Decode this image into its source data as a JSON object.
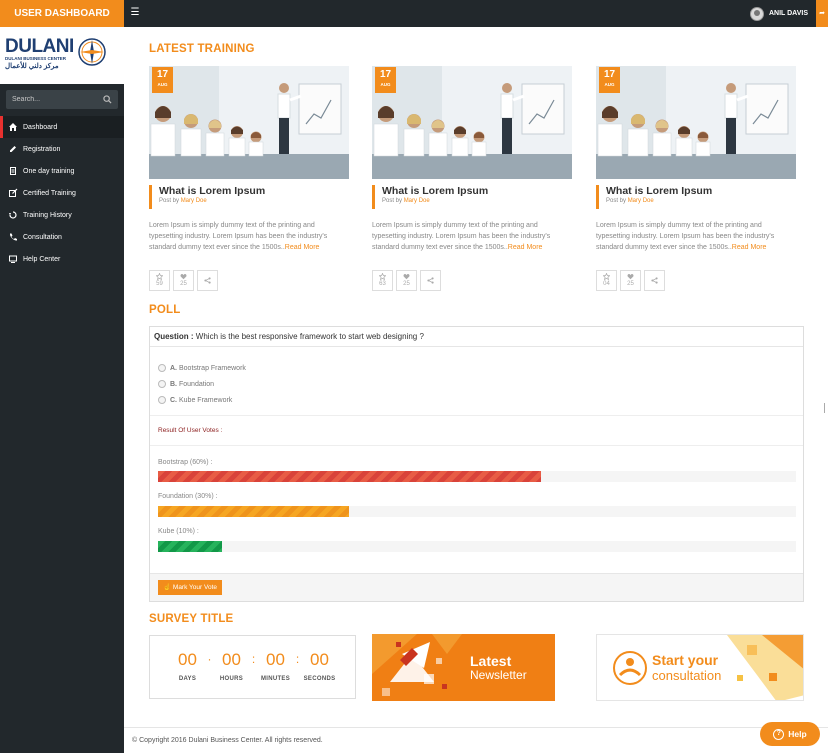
{
  "header": {
    "brand": "USER DASHBOARD",
    "user_name": "ANIL DAVIS"
  },
  "sidebar": {
    "logo_text": "DULANI",
    "logo_sub": "DULANI BUSINESS CENTER",
    "logo_arabic": "مركز دلني للأعمال",
    "search_placeholder": "Search...",
    "items": [
      {
        "label": "Dashboard",
        "icon": "home-icon",
        "active": true
      },
      {
        "label": "Registration",
        "icon": "pencil-icon"
      },
      {
        "label": "One day training",
        "icon": "document-icon"
      },
      {
        "label": "Certified Training",
        "icon": "edit-icon"
      },
      {
        "label": "Training History",
        "icon": "history-icon"
      },
      {
        "label": "Consultation",
        "icon": "phone-icon"
      },
      {
        "label": "Help Center",
        "icon": "help-desk-icon"
      }
    ]
  },
  "training": {
    "title": "LATEST TRAINING",
    "cards": [
      {
        "day": "17",
        "month": "AUG",
        "title": "What is Lorem Ipsum",
        "post_by": "Post by",
        "author": "Mary Doe",
        "body": "Lorem Ipsum is simply dummy text of the printing and typesetting industry. Lorem Ipsum has been the industry's standard dummy text ever since the 1500s..",
        "read_more": "Read More",
        "views": "59",
        "likes": "25"
      },
      {
        "day": "17",
        "month": "AUG",
        "title": "What is Lorem Ipsum",
        "post_by": "Post by",
        "author": "Mary Doe",
        "body": "Lorem Ipsum is simply dummy text of the printing and typesetting industry. Lorem Ipsum has been the industry's standard dummy text ever since the 1500s..",
        "read_more": "Read More",
        "views": "63",
        "likes": "25"
      },
      {
        "day": "17",
        "month": "AUG",
        "title": "What is Lorem Ipsum",
        "post_by": "Post by",
        "author": "Mary Doe",
        "body": "Lorem Ipsum is simply dummy text of the printing and typesetting industry. Lorem Ipsum has been the industry's standard dummy text ever since the 1500s..",
        "read_more": "Read More",
        "views": "04",
        "likes": "25"
      }
    ]
  },
  "poll": {
    "title": "POLL",
    "question_label": "Question :",
    "question": "Which is the best responsive framework to start web designing ?",
    "options": [
      {
        "letter": "A.",
        "label": "Bootstrap Framework"
      },
      {
        "letter": "B.",
        "label": "Foundation"
      },
      {
        "letter": "C.",
        "label": "Kube Framework"
      }
    ],
    "result_label": "Result Of User Votes :",
    "results": [
      {
        "label": "Bootstrap (60%) :",
        "percent": 60,
        "color": "#e04a3c"
      },
      {
        "label": "Foundation (30%) :",
        "percent": 30,
        "color": "#f6a623"
      },
      {
        "label": "Kube (10%) :",
        "percent": 10,
        "color": "#1fa954"
      }
    ],
    "vote_button": "Mark Your Vote"
  },
  "survey": {
    "title": "SURVEY TITLE",
    "countdown": [
      {
        "value": "00",
        "label": "DAYS"
      },
      {
        "value": "00",
        "label": "HOURS"
      },
      {
        "value": "00",
        "label": "MINUTES"
      },
      {
        "value": "00",
        "label": "SECONDS"
      }
    ],
    "newsletter_line1": "Latest",
    "newsletter_line2": "Newsletter",
    "consult_line1": "Start your",
    "consult_line2": "consultation"
  },
  "footer": {
    "copyright": "© Copyright 2016 Dulani Business Center. All rights reserved.",
    "help_label": "Help"
  },
  "colors": {
    "accent": "#f28c1c",
    "dark": "#22282c",
    "active_marker": "#e8312f"
  }
}
